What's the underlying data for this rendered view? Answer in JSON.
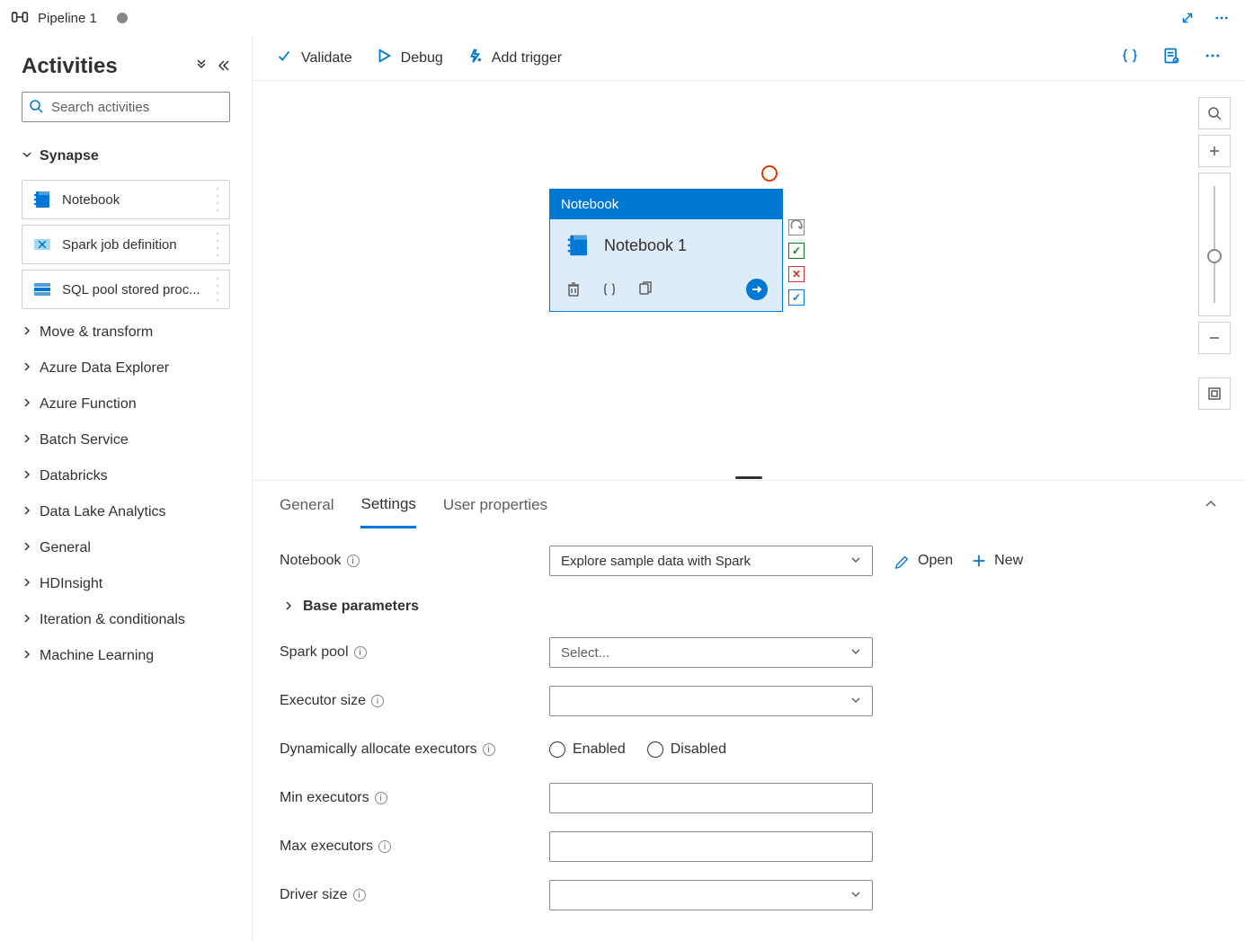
{
  "tab": {
    "title": "Pipeline 1"
  },
  "sidebar": {
    "title": "Activities",
    "search_placeholder": "Search activities",
    "synapse_label": "Synapse",
    "activities": [
      {
        "label": "Notebook"
      },
      {
        "label": "Spark job definition"
      },
      {
        "label": "SQL pool stored proc..."
      }
    ],
    "categories": [
      {
        "label": "Move & transform"
      },
      {
        "label": "Azure Data Explorer"
      },
      {
        "label": "Azure Function"
      },
      {
        "label": "Batch Service"
      },
      {
        "label": "Databricks"
      },
      {
        "label": "Data Lake Analytics"
      },
      {
        "label": "General"
      },
      {
        "label": "HDInsight"
      },
      {
        "label": "Iteration & conditionals"
      },
      {
        "label": "Machine Learning"
      }
    ]
  },
  "toolbar": {
    "validate": "Validate",
    "debug": "Debug",
    "add_trigger": "Add trigger"
  },
  "node": {
    "type": "Notebook",
    "name": "Notebook 1"
  },
  "details": {
    "tabs": {
      "general": "General",
      "settings": "Settings",
      "user_properties": "User properties"
    },
    "form": {
      "notebook_label": "Notebook",
      "notebook_value": "Explore sample data with Spark",
      "open_label": "Open",
      "new_label": "New",
      "base_parameters_label": "Base parameters",
      "spark_pool_label": "Spark pool",
      "spark_pool_placeholder": "Select...",
      "executor_size_label": "Executor size",
      "dyn_alloc_label": "Dynamically allocate executors",
      "enabled_label": "Enabled",
      "disabled_label": "Disabled",
      "min_exec_label": "Min executors",
      "max_exec_label": "Max executors",
      "driver_size_label": "Driver size"
    }
  }
}
